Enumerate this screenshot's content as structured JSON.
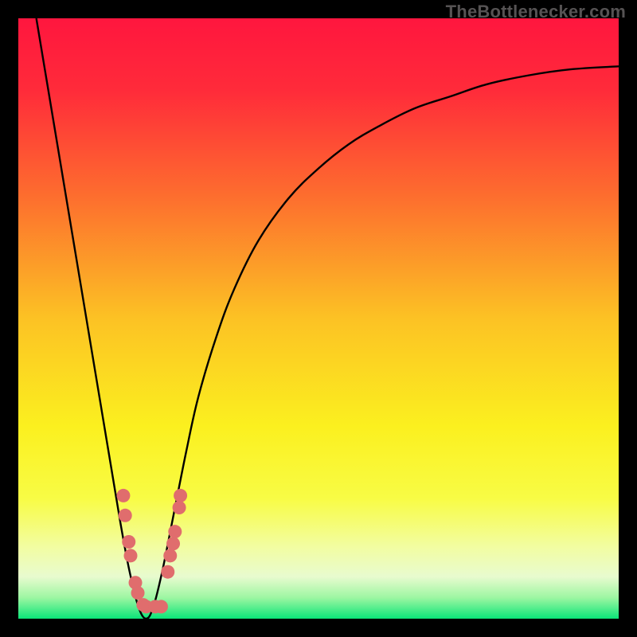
{
  "attribution": "TheBottlenecker.com",
  "chart_data": {
    "type": "line",
    "title": "",
    "xlabel": "",
    "ylabel": "",
    "xlim": [
      0,
      100
    ],
    "ylim": [
      0,
      100
    ],
    "gradient_stops": [
      {
        "offset": 0.0,
        "color": "#ff163e"
      },
      {
        "offset": 0.12,
        "color": "#ff2b3a"
      },
      {
        "offset": 0.3,
        "color": "#fd6f2e"
      },
      {
        "offset": 0.5,
        "color": "#fcc224"
      },
      {
        "offset": 0.68,
        "color": "#fbf01f"
      },
      {
        "offset": 0.8,
        "color": "#f8fc45"
      },
      {
        "offset": 0.88,
        "color": "#f2fda1"
      },
      {
        "offset": 0.93,
        "color": "#e8fbcf"
      },
      {
        "offset": 0.965,
        "color": "#9df6a2"
      },
      {
        "offset": 1.0,
        "color": "#0be578"
      }
    ],
    "series": [
      {
        "name": "bottleneck-curve",
        "x": [
          3,
          5,
          7,
          9,
          11,
          13,
          15,
          17,
          18.5,
          20,
          21.3,
          22.5,
          24,
          26,
          28,
          30,
          33,
          36,
          40,
          45,
          50,
          55,
          60,
          66,
          72,
          78,
          85,
          92,
          100
        ],
        "y": [
          100,
          88,
          76,
          64,
          52,
          40,
          28,
          16,
          8,
          2,
          0,
          2,
          8,
          18,
          28,
          37,
          47,
          55,
          63,
          70,
          75,
          79,
          82,
          85,
          87,
          89,
          90.5,
          91.5,
          92
        ]
      }
    ],
    "markers": {
      "name": "benchmark-points",
      "color": "#e06d6d",
      "points": [
        {
          "x": 17.5,
          "y": 20.5
        },
        {
          "x": 17.8,
          "y": 17.2
        },
        {
          "x": 18.4,
          "y": 12.8
        },
        {
          "x": 18.7,
          "y": 10.5
        },
        {
          "x": 19.5,
          "y": 6.0
        },
        {
          "x": 19.9,
          "y": 4.3
        },
        {
          "x": 20.8,
          "y": 2.3
        },
        {
          "x": 21.3,
          "y": 2.0
        },
        {
          "x": 22.8,
          "y": 2.0
        },
        {
          "x": 23.8,
          "y": 2.0
        },
        {
          "x": 24.9,
          "y": 7.8
        },
        {
          "x": 25.3,
          "y": 10.5
        },
        {
          "x": 25.8,
          "y": 12.5
        },
        {
          "x": 26.1,
          "y": 14.5
        },
        {
          "x": 26.8,
          "y": 18.5
        },
        {
          "x": 27.0,
          "y": 20.5
        }
      ]
    }
  }
}
